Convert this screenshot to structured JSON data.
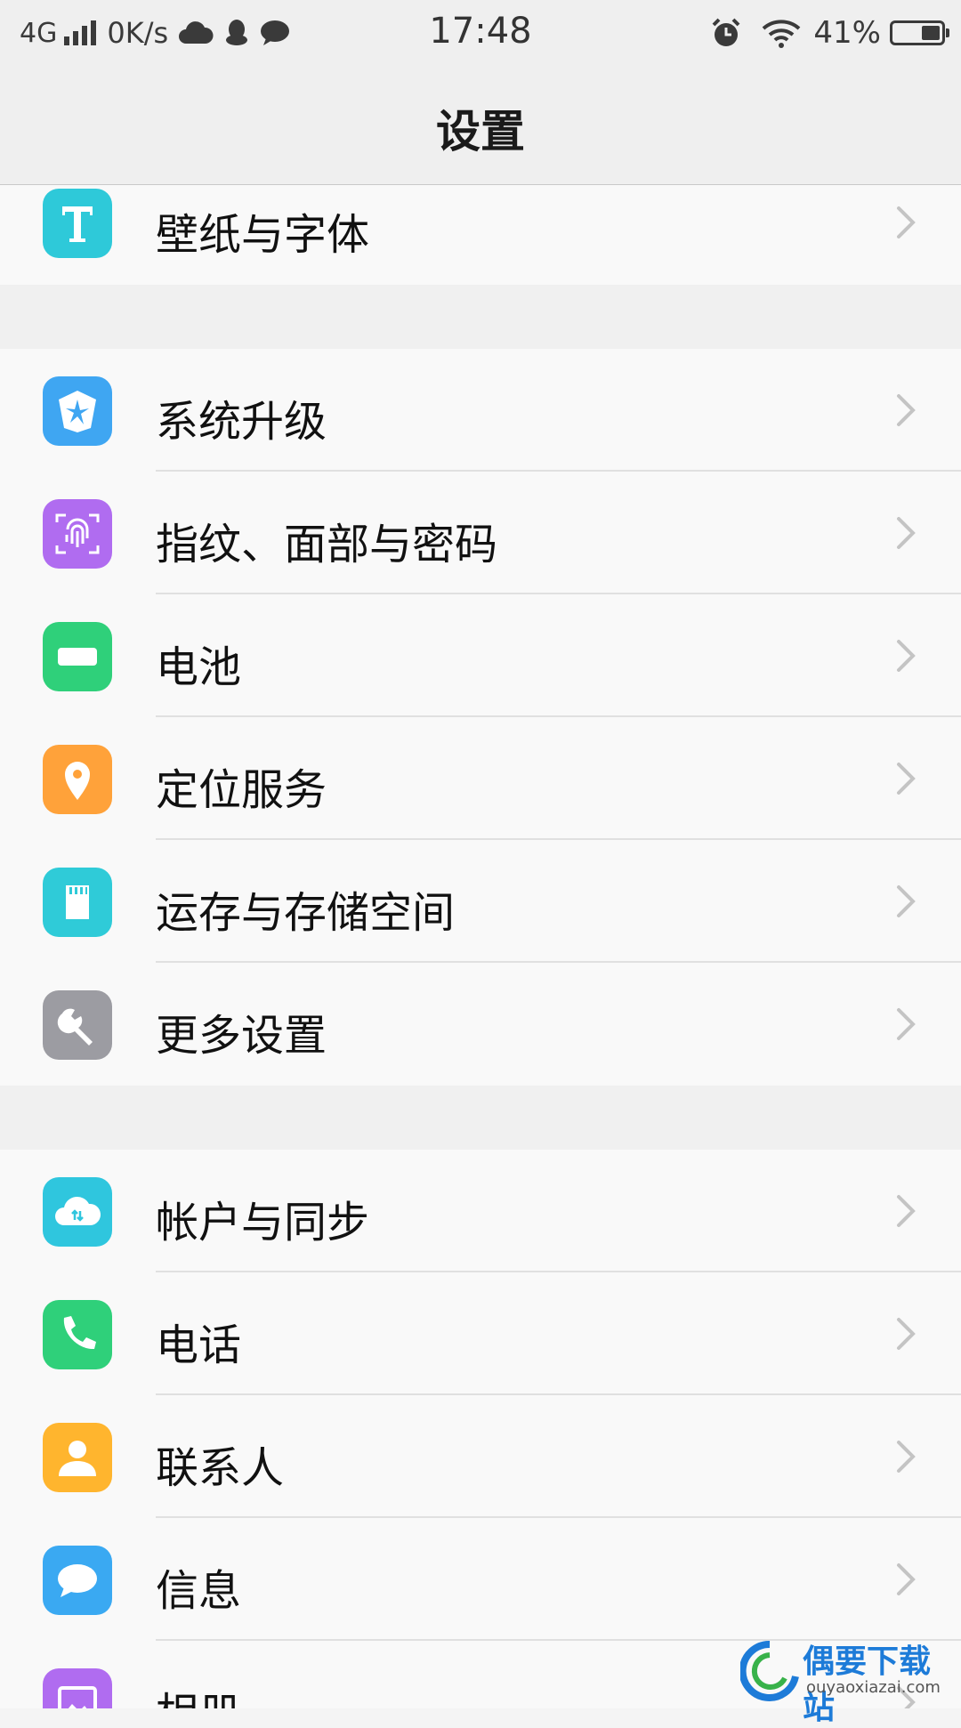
{
  "status_bar": {
    "network": "4G",
    "speed": "0K/s",
    "time": "17:48",
    "battery_percent": "41%",
    "battery_level": 0.41,
    "icons_left": [
      "signal-icon",
      "cloud-icon",
      "qq-icon",
      "message-icon"
    ],
    "icons_right": [
      "alarm-icon",
      "wifi-icon",
      "battery-icon"
    ]
  },
  "header": {
    "title": "设置"
  },
  "groups": [
    {
      "items": [
        {
          "label": "壁纸与字体",
          "icon": "font-icon",
          "color": "#2ec9d9"
        }
      ]
    },
    {
      "items": [
        {
          "label": "系统升级",
          "icon": "system-update-icon",
          "color": "#3fa6f2"
        },
        {
          "label": "指纹、面部与密码",
          "icon": "fingerprint-icon",
          "color": "#b06cf0"
        },
        {
          "label": "电池",
          "icon": "battery-icon",
          "color": "#2fd07a"
        },
        {
          "label": "定位服务",
          "icon": "location-pin-icon",
          "color": "#ffa23a"
        },
        {
          "label": "运存与存储空间",
          "icon": "sd-card-icon",
          "color": "#2fcbd8"
        },
        {
          "label": "更多设置",
          "icon": "wrench-icon",
          "color": "#9c9ca2"
        }
      ]
    },
    {
      "items": [
        {
          "label": "帐户与同步",
          "icon": "cloud-sync-icon",
          "color": "#2fc6de"
        },
        {
          "label": "电话",
          "icon": "phone-icon",
          "color": "#2fd07a"
        },
        {
          "label": "联系人",
          "icon": "contact-icon",
          "color": "#ffb52e"
        },
        {
          "label": "信息",
          "icon": "chat-bubble-icon",
          "color": "#3aa9f2"
        },
        {
          "label": "相册",
          "icon": "photo-album-icon",
          "color": "#b06cf0"
        }
      ]
    }
  ],
  "watermark": {
    "name": "偶要下载站",
    "url": "ouyaoxiazai.com"
  }
}
